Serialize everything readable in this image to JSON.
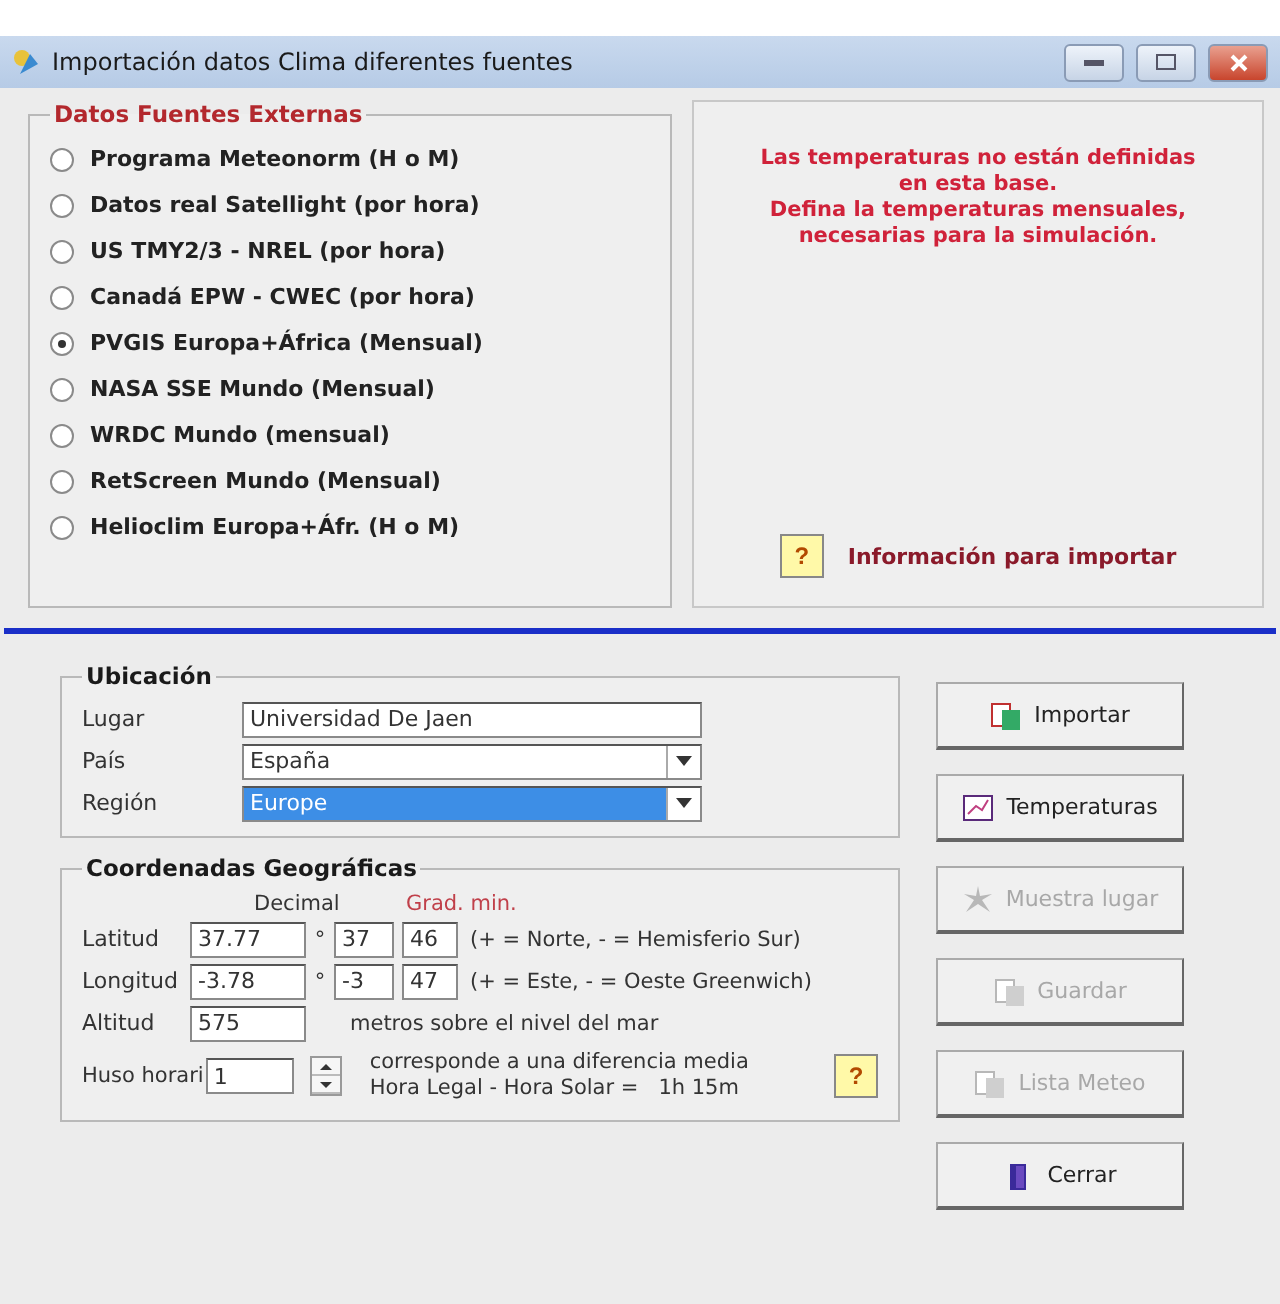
{
  "window": {
    "title": "Importación datos Clima diferentes fuentes"
  },
  "sources": {
    "title": "Datos Fuentes Externas",
    "options": [
      {
        "label": "Programa Meteonorm (H o M)",
        "selected": false
      },
      {
        "label": "Datos real Satellight (por hora)",
        "selected": false
      },
      {
        "label": "US TMY2/3 - NREL (por hora)",
        "selected": false
      },
      {
        "label": "Canadá EPW - CWEC (por hora)",
        "selected": false
      },
      {
        "label": "PVGIS Europa+África (Mensual)",
        "selected": true
      },
      {
        "label": "NASA SSE Mundo (Mensual)",
        "selected": false
      },
      {
        "label": "WRDC Mundo (mensual)",
        "selected": false
      },
      {
        "label": "RetScreen Mundo (Mensual)",
        "selected": false
      },
      {
        "label": "Helioclim Europa+Áfr. (H o M)",
        "selected": false
      }
    ]
  },
  "notice": {
    "message_lines": [
      "Las temperaturas no están definidas",
      "en esta base.",
      "Defina la temperaturas mensuales,",
      "necesarias para la simulación."
    ],
    "info_button": "?",
    "info_label": "Información para importar"
  },
  "location": {
    "title": "Ubicación",
    "fields": [
      {
        "label": "Lugar",
        "value": "Universidad De Jaen",
        "kind": "text"
      },
      {
        "label": "País",
        "value": "España",
        "kind": "dropdown",
        "focused": false
      },
      {
        "label": "Región",
        "value": "Europe",
        "kind": "dropdown",
        "focused": true
      }
    ]
  },
  "coordinates": {
    "title": "Coordenadas Geográficas",
    "decimal_header": "Decimal",
    "degmin_header": "Grad. min.",
    "rows": [
      {
        "label": "Latitud",
        "decimal": "37.77",
        "degree_sign": "°",
        "degrees": "37",
        "minutes": "46",
        "note": "(+ = Norte, - = Hemisferio Sur)"
      },
      {
        "label": "Longitud",
        "decimal": "-3.78",
        "degree_sign": "°",
        "degrees": "-3",
        "minutes": "47",
        "note": "(+ = Este, - = Oeste Greenwich)"
      }
    ],
    "altitude": {
      "label": "Altitud",
      "value": "575",
      "note": "metros sobre el nivel del mar"
    },
    "timezone": {
      "label": "Huso horari",
      "value": "1",
      "note_lines": [
        "corresponde a una diferencia media",
        "Hora Legal - Hora Solar =   1h 15m"
      ],
      "help": "?"
    }
  },
  "actions": [
    {
      "label": "Importar",
      "disabled": false,
      "kind": "import"
    },
    {
      "label": "Temperaturas",
      "disabled": false,
      "kind": "chart"
    },
    {
      "label": "Muestra lugar",
      "disabled": true,
      "kind": "map"
    },
    {
      "label": "Guardar",
      "disabled": true,
      "kind": "save"
    },
    {
      "label": "Lista Meteo",
      "disabled": true,
      "kind": "list"
    },
    {
      "label": "Cerrar",
      "disabled": false,
      "kind": "exit"
    }
  ]
}
